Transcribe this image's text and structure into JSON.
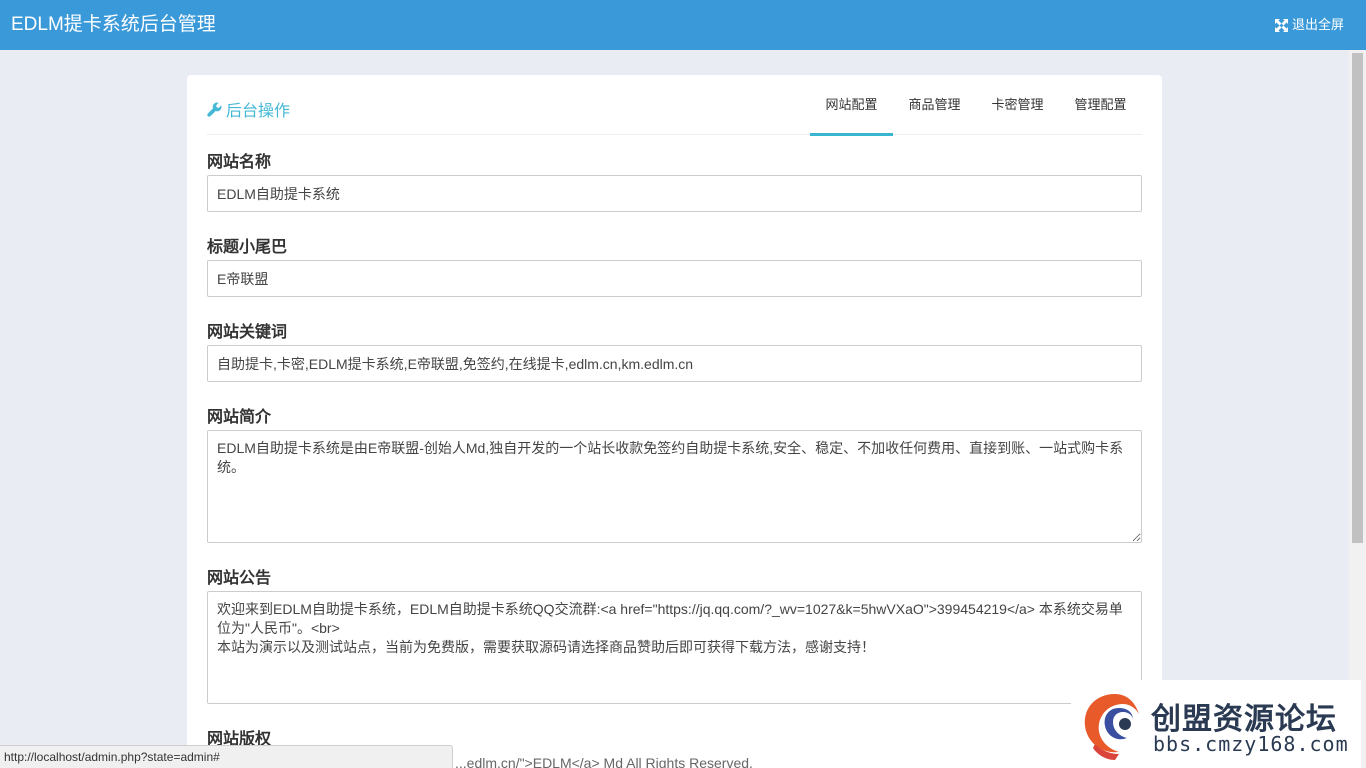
{
  "app": {
    "title": "EDLM提卡系统后台管理",
    "exit_fullscreen_label": "退出全屏"
  },
  "panel": {
    "title": "后台操作",
    "tabs": [
      {
        "label": "网站配置",
        "active": true
      },
      {
        "label": "商品管理",
        "active": false
      },
      {
        "label": "卡密管理",
        "active": false
      },
      {
        "label": "管理配置",
        "active": false
      }
    ]
  },
  "form": {
    "site_name": {
      "label": "网站名称",
      "value": "EDLM自助提卡系统"
    },
    "title_suffix": {
      "label": "标题小尾巴",
      "value": "E帝联盟"
    },
    "keywords": {
      "label": "网站关键词",
      "value": "自助提卡,卡密,EDLM提卡系统,E帝联盟,免签约,在线提卡,edlm.cn,km.edlm.cn"
    },
    "description": {
      "label": "网站简介",
      "value": "EDLM自助提卡系统是由E帝联盟-创始人Md,独自开发的一个站长收款免签约自助提卡系统,安全、稳定、不加收任何费用、直接到账、一站式购卡系统。"
    },
    "notice": {
      "label": "网站公告",
      "value": "欢迎来到EDLM自助提卡系统，EDLM自助提卡系统QQ交流群:<a href=\"https://jq.qq.com/?_wv=1027&k=5hwVXaO\">399454219</a> 本系统交易单位为\"人民币\"。<br>\n本站为演示以及测试站点，当前为免费版，需要获取源码请选择商品赞助后即可获得下载方法，感谢支持！"
    },
    "copyright": {
      "label": "网站版权",
      "partial_value": "...edlm.cn/\">EDLM</a> Md All Rights Reserved."
    }
  },
  "status_bar": {
    "url": "http://localhost/admin.php?state=admin#"
  },
  "watermark": {
    "title": "创盟资源论坛",
    "subtitle": "bbs.cmzy168.com"
  },
  "colors": {
    "header": "#3a99d9",
    "accent": "#3ab5cf",
    "background": "#e9ecf3"
  }
}
